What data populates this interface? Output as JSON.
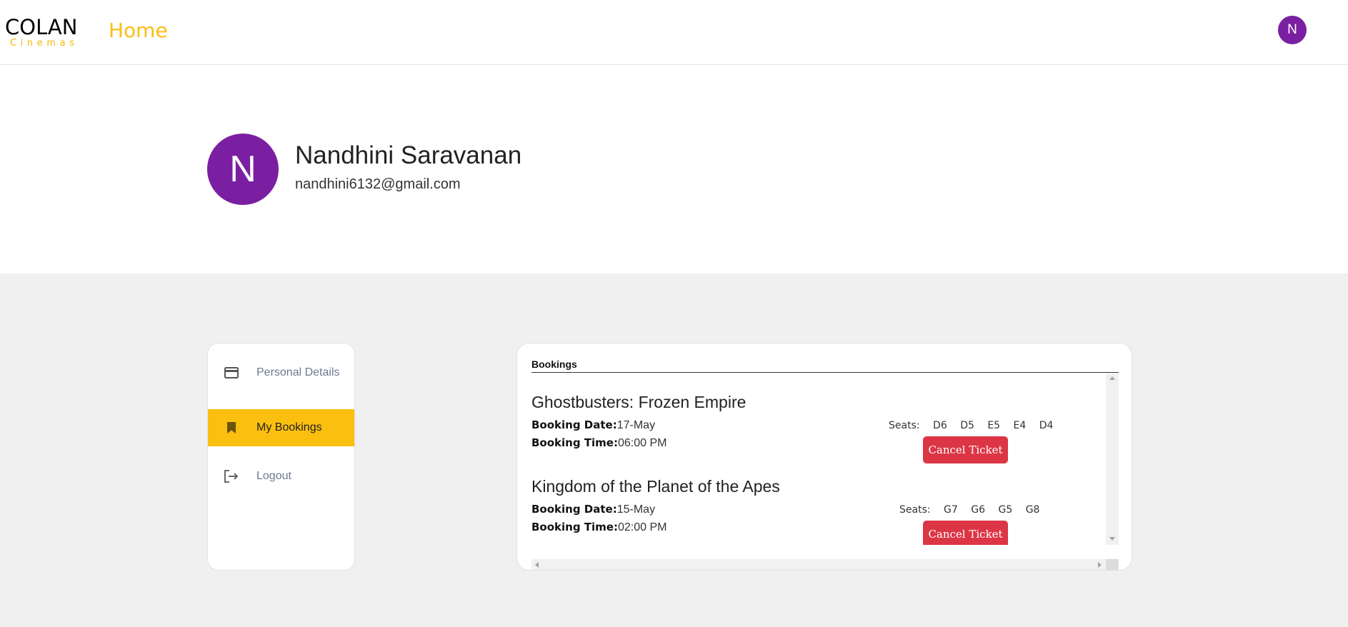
{
  "brand": {
    "name": "COLAN",
    "tagline": "Cinemas"
  },
  "nav": {
    "home_label": "Home",
    "avatar_initial": "N"
  },
  "profile": {
    "initial": "N",
    "name": "Nandhini Saravanan",
    "email": "nandhini6132@gmail.com"
  },
  "sidebar": {
    "items": [
      {
        "label": "Personal Details",
        "icon": "credit-card-icon",
        "active": false
      },
      {
        "label": "My Bookings",
        "icon": "bookmark-icon",
        "active": true
      },
      {
        "label": "Logout",
        "icon": "logout-icon",
        "active": false
      }
    ]
  },
  "bookings": {
    "title": "Bookings",
    "date_label": "Booking Date:",
    "time_label": "Booking Time:",
    "seats_label": "Seats:",
    "cancel_label": "Cancel Ticket",
    "items": [
      {
        "movie": "Ghostbusters: Frozen Empire",
        "date": "17-May",
        "time": "06:00 PM",
        "seats": [
          "D6",
          "D5",
          "E5",
          "E4",
          "D4"
        ]
      },
      {
        "movie": "Kingdom of the Planet of the Apes",
        "date": "15-May",
        "time": "02:00 PM",
        "seats": [
          "G7",
          "G6",
          "G5",
          "G8"
        ]
      }
    ]
  },
  "colors": {
    "accent": "#fbbf0f",
    "avatar": "#7b1fa2",
    "danger": "#dc3545",
    "page_bg": "#f0f0f0"
  }
}
